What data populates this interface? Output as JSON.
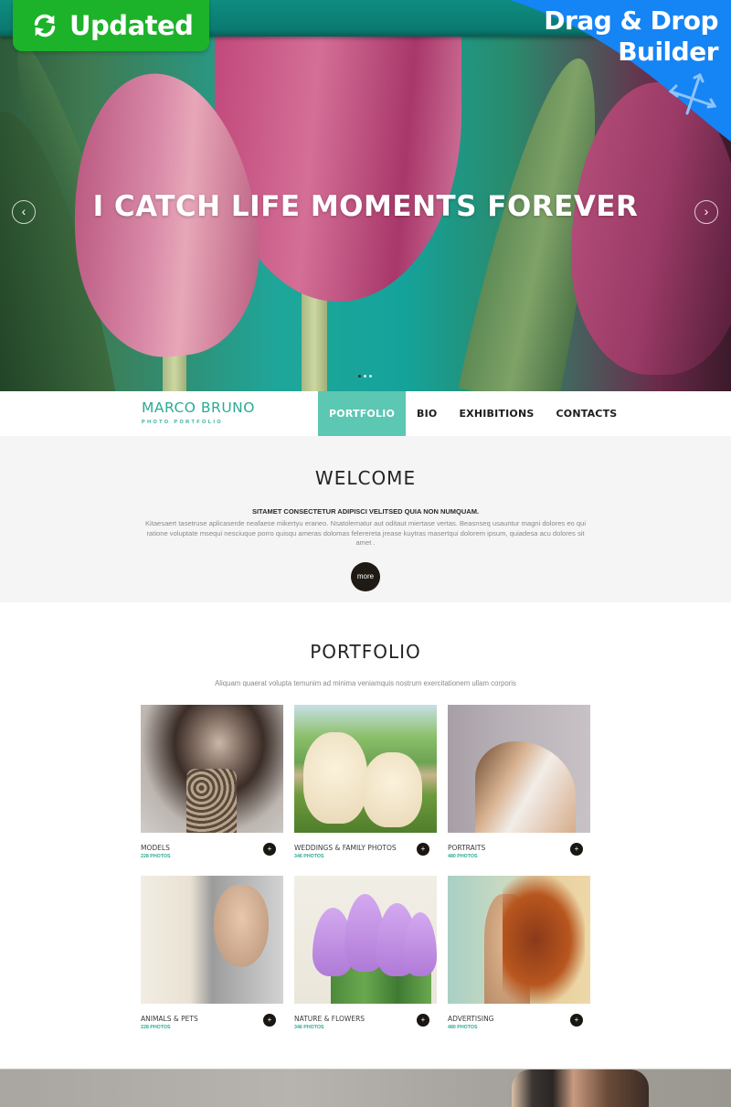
{
  "badges": {
    "updated": {
      "label": "Updated",
      "icon": "refresh-icon",
      "color": "#1cb22a"
    },
    "drag_drop": {
      "line1": "Drag & Drop",
      "line2": "Builder",
      "icon": "move-arrows-icon",
      "color": "#1584f5"
    }
  },
  "hero": {
    "headline": "I CATCH LIFE MOMENTS FOREVER",
    "prev_icon": "‹",
    "next_icon": "›",
    "slides_total": 3,
    "active_slide": 1
  },
  "nav": {
    "brand_name": "MARCO BRUNO",
    "brand_tagline": "PHOTO PORTFOLIO",
    "accent_color": "#5cc7b2",
    "items": [
      {
        "label": "PORTFOLIO",
        "active": true
      },
      {
        "label": "BIO",
        "active": false
      },
      {
        "label": "EXHIBITIONS",
        "active": false
      },
      {
        "label": "CONTACTS",
        "active": false
      }
    ]
  },
  "welcome": {
    "title": "WELCOME",
    "lead": "SITAMET CONSECTETUR ADIPISCI VELITSED QUIA NON NUMQUAM.",
    "body": "Kitaesaert tasetruse aplicaserde neafaese mikertyu eraneo. Nsatolernatur aut oditaut miertase vertas.  Beasnseq usauntur magni dolores eo qui ratione voluptate msequi nesciuque porro quisqu ameras dolomas felerereta jrease kuytras masertqui dolorem ipsum, quiadesa acu dolores sit amet .",
    "more_label": "more"
  },
  "portfolio": {
    "title": "PORTFOLIO",
    "subtitle": "Aliquam quaerat volupta temunim ad minima veniamquis nostrum exercitationem ullam corporis",
    "plus_label": "+",
    "items": [
      {
        "title": "MODELS",
        "count": "228 PHOTOS"
      },
      {
        "title": "WEDDINGS & FAMILY PHOTOS",
        "count": "346 PHOTOS"
      },
      {
        "title": "PORTRAITS",
        "count": "480 PHOTOS"
      },
      {
        "title": "ANIMALS & PETS",
        "count": "228 PHOTOS"
      },
      {
        "title": "NATURE & FLOWERS",
        "count": "346 PHOTOS"
      },
      {
        "title": "ADVERTISING",
        "count": "480 PHOTOS"
      }
    ]
  }
}
